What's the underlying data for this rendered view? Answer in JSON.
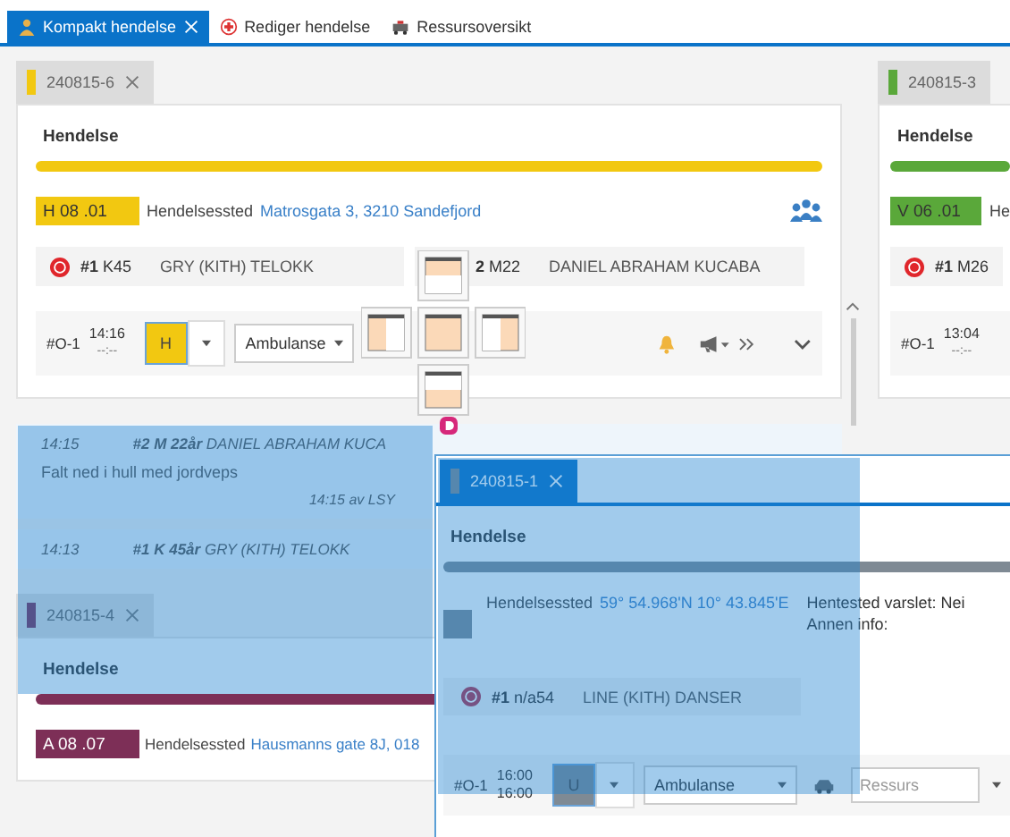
{
  "app_tabs": [
    {
      "label": "Kompakt hendelse",
      "selected": true
    },
    {
      "label": "Rediger hendelse",
      "selected": false
    },
    {
      "label": "Ressursoversikt",
      "selected": false
    }
  ],
  "main_incident": {
    "id": "240815-6",
    "color": "#f2c811",
    "heading": "Hendelse",
    "code": "H 08 .01",
    "place_label": "Hendelsessted",
    "place": "Matrosgata 3, 3210 Sandefjord",
    "patients": [
      {
        "number": "#1",
        "age": "K45",
        "name": "GRY (KITH) TELOKK",
        "badge": true
      },
      {
        "number": "2",
        "age": "M22",
        "name": "DANIEL ABRAHAM KUCABA",
        "badge": false
      }
    ],
    "resource": {
      "id": "#O-1",
      "time": "14:16",
      "eta": "--:--",
      "priority": "H",
      "type": "Ambulanse"
    }
  },
  "log": [
    {
      "time": "14:15",
      "text": "**#2 M 22år** DANIEL ABRAHAM KUCA",
      "note": "Falt ned i hull med jordveps",
      "footer": "14:15 av LSY"
    },
    {
      "time": "14:13",
      "text": "**#1 K 45år** GRY (KITH) TELOKK"
    }
  ],
  "lower_incident": {
    "id": "240815-4",
    "color": "#7d2f57",
    "heading": "Hendelse",
    "code": "A 08 .07",
    "place_label": "Hendelsessted",
    "place": "Hausmanns gate 8J, 018"
  },
  "side_incident": {
    "id": "240815-3",
    "color": "#5aa83a",
    "heading": "Hendelse",
    "code": "V 06 .01",
    "place_label": "He",
    "patient": {
      "number": "#1",
      "age": "M26"
    },
    "resource": {
      "id": "#O-1",
      "time": "13:04",
      "eta": "--:--"
    }
  },
  "floating_window": {
    "tab": "240815-1",
    "color": "#7f8a94",
    "heading": "Hendelse",
    "place_label": "Hendelsessted",
    "place": "59° 54.968'N 10° 43.845'E",
    "notified": "Hentested varslet: Nei",
    "other": "Annen info:",
    "patient": {
      "number": "#1",
      "age": "n/a54",
      "name": "LINE (KITH) DANSER"
    },
    "resource": {
      "id": "#O-1",
      "time": "16:00",
      "eta": "16:00",
      "priority": "U",
      "type": "Ambulanse",
      "placeholder": "Ressurs"
    }
  }
}
